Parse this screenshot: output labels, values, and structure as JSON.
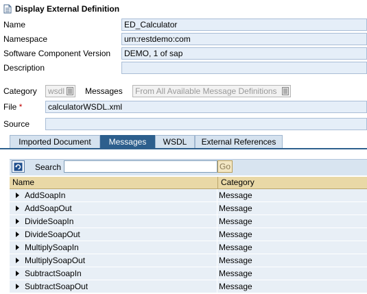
{
  "header": {
    "title": "Display External Definition",
    "icon": "document-icon"
  },
  "fields": {
    "name": {
      "label": "Name",
      "value": "ED_Calculator"
    },
    "namespace": {
      "label": "Namespace",
      "value": "urn:restdemo:com"
    },
    "swcv": {
      "label": "Software Component Version",
      "value": "DEMO, 1 of sap"
    },
    "description": {
      "label": "Description",
      "value": ""
    },
    "category": {
      "label": "Category",
      "value": "wsdl"
    },
    "messages": {
      "label": "Messages",
      "value": "From All Available Message Definitions"
    },
    "file": {
      "label": "File",
      "required_marker": "*",
      "value": "calculatorWSDL.xml"
    },
    "source": {
      "label": "Source",
      "value": ""
    }
  },
  "tabs": [
    {
      "label": "Imported Document",
      "active": false
    },
    {
      "label": "Messages",
      "active": true
    },
    {
      "label": "WSDL",
      "active": false
    },
    {
      "label": "External References",
      "active": false
    }
  ],
  "toolbar": {
    "refresh_icon": "refresh-icon",
    "search_label": "Search",
    "search_value": "",
    "go_label": "Go"
  },
  "table": {
    "columns": [
      "Name",
      "Category"
    ],
    "rows": [
      {
        "name": "AddSoapIn",
        "category": "Message"
      },
      {
        "name": "AddSoapOut",
        "category": "Message"
      },
      {
        "name": "DivideSoapIn",
        "category": "Message"
      },
      {
        "name": "DivideSoapOut",
        "category": "Message"
      },
      {
        "name": "MultiplySoapIn",
        "category": "Message"
      },
      {
        "name": "MultiplySoapOut",
        "category": "Message"
      },
      {
        "name": "SubtractSoapIn",
        "category": "Message"
      },
      {
        "name": "SubtractSoapOut",
        "category": "Message"
      }
    ]
  },
  "colors": {
    "accent": "#2d5f8d",
    "field_bg": "#e5eef8",
    "header_bg": "#e9d8a6",
    "row_bg": "#e8eff6"
  }
}
